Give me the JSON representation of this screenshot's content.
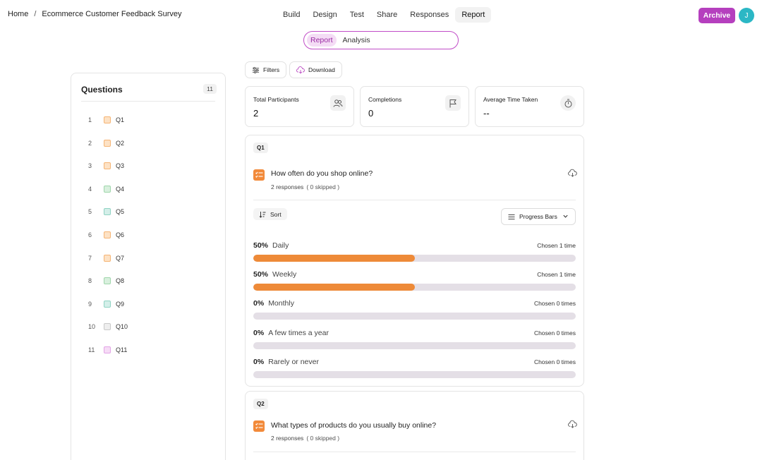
{
  "breadcrumb": {
    "home": "Home",
    "separator": "/",
    "survey": "Ecommerce Customer Feedback Survey"
  },
  "nav": {
    "tabs": [
      "Build",
      "Design",
      "Test",
      "Share",
      "Responses",
      "Report"
    ],
    "active": "Report"
  },
  "header_actions": {
    "archive_label": "Archive",
    "avatar_initial": "J"
  },
  "subview": {
    "options": [
      "Report",
      "Analysis"
    ],
    "active": "Report"
  },
  "toolbar": {
    "filters_label": "Filters",
    "download_label": "Download"
  },
  "sidebar": {
    "title": "Questions",
    "count": "11",
    "items": [
      {
        "num": "1",
        "label": "Q1",
        "icon": "orange"
      },
      {
        "num": "2",
        "label": "Q2",
        "icon": "orange"
      },
      {
        "num": "3",
        "label": "Q3",
        "icon": "orange"
      },
      {
        "num": "4",
        "label": "Q4",
        "icon": "green"
      },
      {
        "num": "5",
        "label": "Q5",
        "icon": "teal"
      },
      {
        "num": "6",
        "label": "Q6",
        "icon": "orange"
      },
      {
        "num": "7",
        "label": "Q7",
        "icon": "orange"
      },
      {
        "num": "8",
        "label": "Q8",
        "icon": "green"
      },
      {
        "num": "9",
        "label": "Q9",
        "icon": "teal"
      },
      {
        "num": "10",
        "label": "Q10",
        "icon": "gray"
      },
      {
        "num": "11",
        "label": "Q11",
        "icon": "pink"
      }
    ]
  },
  "stats": [
    {
      "label": "Total Participants",
      "value": "2",
      "icon": "users-icon"
    },
    {
      "label": "Completions",
      "value": "0",
      "icon": "flag-icon"
    },
    {
      "label": "Average Time Taken",
      "value": "--",
      "icon": "stopwatch-icon"
    }
  ],
  "questions": [
    {
      "tag": "Q1",
      "text": "How often do you shop online?",
      "responses": "2 responses",
      "skipped": "( 0 skipped )",
      "sort_label": "Sort",
      "view_label": "Progress Bars",
      "options": [
        {
          "pct": "50%",
          "label": "Daily",
          "chosen": "Chosen 1 time",
          "fraction": 0.5
        },
        {
          "pct": "50%",
          "label": "Weekly",
          "chosen": "Chosen 1 time",
          "fraction": 0.5
        },
        {
          "pct": "0%",
          "label": "Monthly",
          "chosen": "Chosen 0 times",
          "fraction": 0
        },
        {
          "pct": "0%",
          "label": "A few times a year",
          "chosen": "Chosen 0 times",
          "fraction": 0
        },
        {
          "pct": "0%",
          "label": "Rarely or never",
          "chosen": "Chosen 0 times",
          "fraction": 0
        }
      ]
    },
    {
      "tag": "Q2",
      "text": "What types of products do you usually buy online?",
      "responses": "2 responses",
      "skipped": "( 0 skipped )"
    }
  ],
  "colors": {
    "accent": "#b53fbe",
    "bar_fill": "#ee8a38",
    "bar_track": "#e4dfe6",
    "avatar": "#2bb7c5"
  }
}
